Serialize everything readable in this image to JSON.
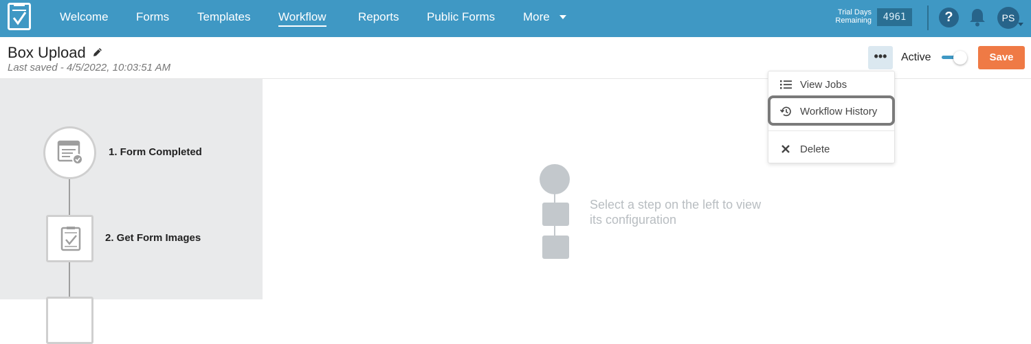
{
  "nav": {
    "items": [
      "Welcome",
      "Forms",
      "Templates",
      "Workflow",
      "Reports",
      "Public Forms",
      "More"
    ],
    "active": "Workflow"
  },
  "trial": {
    "label": "Trial Days Remaining",
    "days": "4961"
  },
  "user": {
    "initials": "PS"
  },
  "help_glyph": "?",
  "workflow": {
    "title": "Box Upload",
    "last_saved": "Last saved - 4/5/2022, 10:03:51 AM",
    "active_label": "Active",
    "active_on": true,
    "save_label": "Save",
    "more_label": "•••"
  },
  "menu": {
    "view_jobs": "View Jobs",
    "history": "Workflow History",
    "delete": "Delete"
  },
  "steps": [
    "1. Form Completed",
    "2. Get Form Images"
  ],
  "empty_state": "Select a step on the left to view its configuration",
  "colors": {
    "brand": "#3f98c4",
    "save": "#ef7a45",
    "panel": "#e9eaeb"
  },
  "icons": [
    "logo-icon",
    "pencil-icon",
    "help-icon",
    "bell-icon",
    "list-icon",
    "history-icon",
    "close-icon",
    "form-icon",
    "tablet-check-icon"
  ]
}
